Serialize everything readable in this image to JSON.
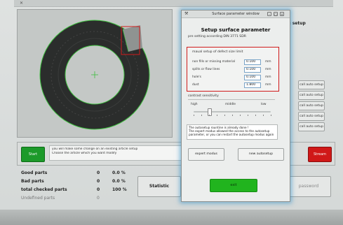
{
  "app": {
    "window_title": "",
    "side_heading": "ing setup",
    "side_buttons": [
      "call auto setup",
      "call auto setup",
      "call auto setup",
      "call auto setup",
      "call auto setup"
    ],
    "start_label": "Start",
    "stop_label": "Stream",
    "info_lines": [
      "you will make some change on an existing article setup",
      "Choose the article which you want modify"
    ],
    "stats": {
      "good_label": "Good parts",
      "good_val": "0",
      "good_pct": "0.0 %",
      "bad_label": "Bad parts",
      "bad_val": "0",
      "bad_pct": "0.0 %",
      "total_label": "total checked parts",
      "total_val": "0",
      "total_pct": "100 %",
      "undef_label": "Undefined parts",
      "undef_val": "0"
    },
    "statistic_label": "Statistic",
    "password_label": "password"
  },
  "dialog": {
    "title": "Surface parameter window",
    "heading": "Setup surface parameter",
    "preset_text": "pre setting according DIN 3771 SDR",
    "limits": {
      "title": "maual setup of defect size limit",
      "rows": [
        {
          "label": "non fills or missing material",
          "value": "0.100",
          "unit": "mm"
        },
        {
          "label": "splits or flow lines",
          "value": "0.100",
          "unit": "mm"
        },
        {
          "label": "hole's",
          "value": "0.100",
          "unit": "mm"
        },
        {
          "label": "dust",
          "value": "1.800",
          "unit": "mm"
        }
      ]
    },
    "contrast": {
      "title": "contrast sensitivity",
      "high": "high",
      "middle": "middle",
      "low": "low",
      "value": 0.2
    },
    "message_lines": [
      "The autosetup rountine is already done !",
      "The expert modus allowed the access to the autosetup",
      "parameter, or you can restart the autosetup modus again"
    ],
    "expert_label": "expert modus",
    "new_autosetup_label": "new autosetup",
    "exit_label": "exit"
  },
  "colors": {
    "ring_outline": "#3fbf3f",
    "defect_box": "#d01b1b",
    "start_green": "#1c9a2a",
    "stop_red": "#d01818",
    "exit_green": "#21b41e",
    "dialog_glow": "#2a8cc8"
  }
}
